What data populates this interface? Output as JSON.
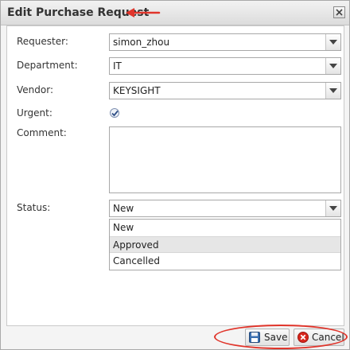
{
  "dialog": {
    "title": "Edit Purchase Request"
  },
  "form": {
    "requester_label": "Requester:",
    "requester_value": "simon_zhou",
    "department_label": "Department:",
    "department_value": "IT",
    "vendor_label": "Vendor:",
    "vendor_value": "KEYSIGHT",
    "urgent_label": "Urgent:",
    "urgent_checked": true,
    "comment_label": "Comment:",
    "comment_value": "",
    "status_label": "Status:",
    "status_value": "New",
    "status_options": [
      "New",
      "Approved",
      "Cancelled"
    ],
    "status_highlighted": "Approved"
  },
  "footer": {
    "save_label": "Save",
    "cancel_label": "Cancel"
  },
  "colors": {
    "annotation_red": "#e0352b",
    "save_icon_blue": "#3a6fb0",
    "cancel_icon_red": "#d8261c"
  },
  "icons": {
    "close": "close-icon",
    "dropdown": "chevron-down-icon",
    "checkbox": "checkmark-icon",
    "save": "floppy-disk-icon",
    "cancel": "cancel-x-icon",
    "annotation": "red-arrow-annotation"
  }
}
